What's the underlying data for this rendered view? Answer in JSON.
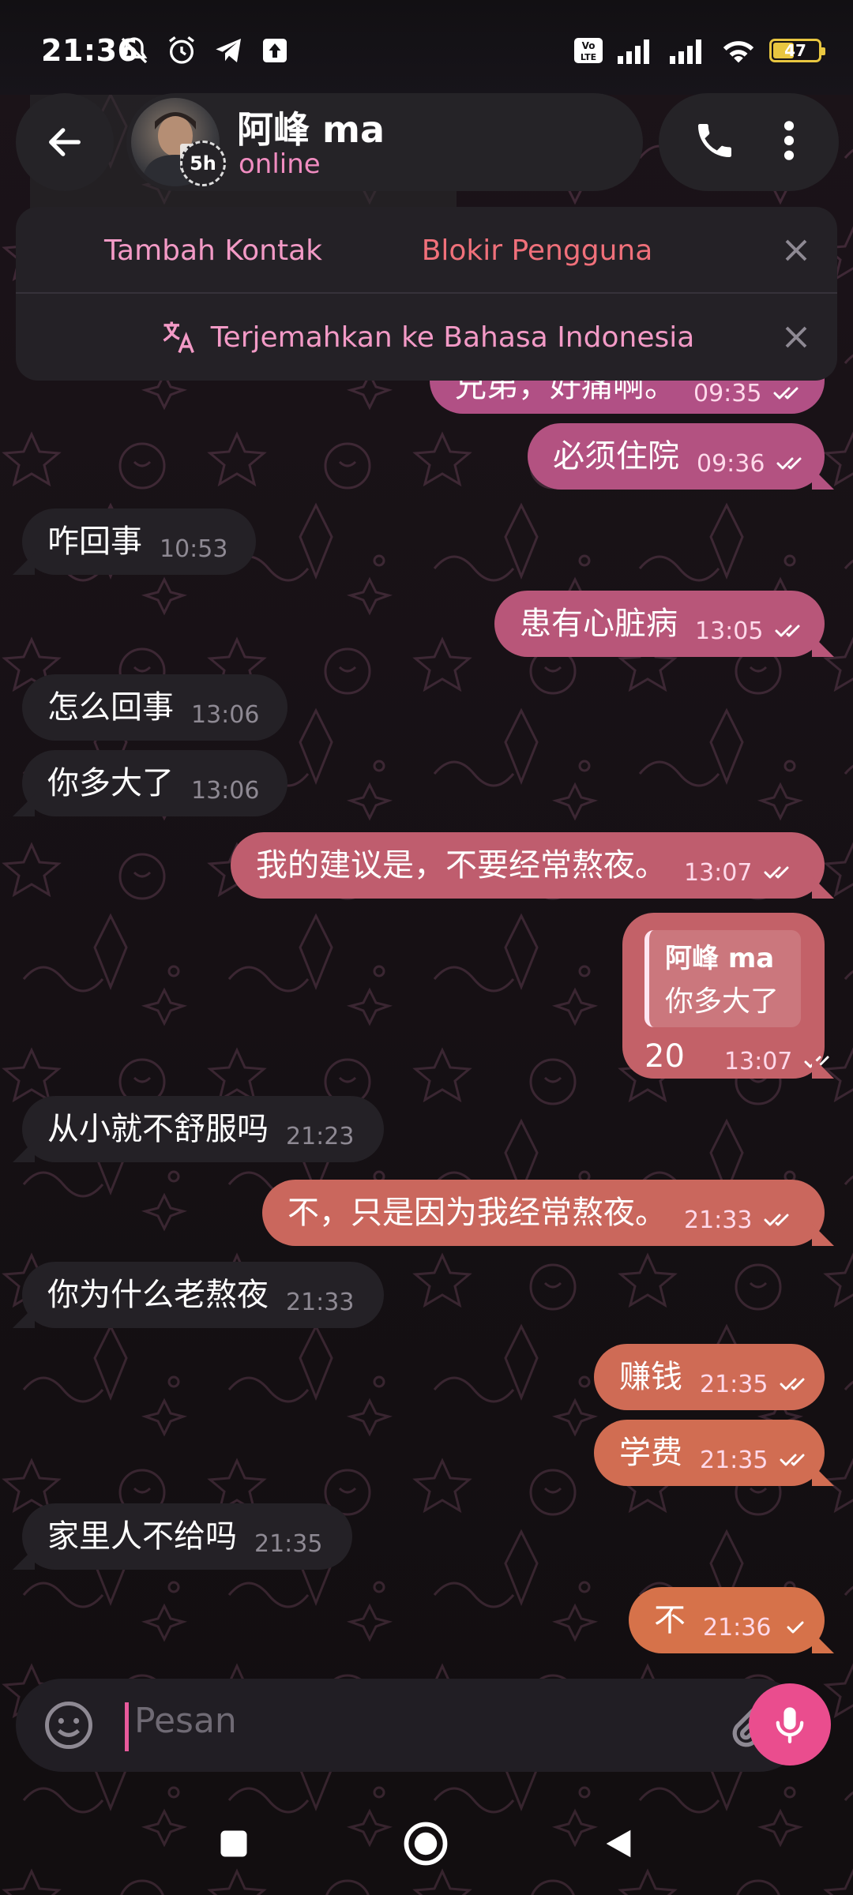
{
  "status_bar": {
    "time": "21:36",
    "battery": "47",
    "battery_level": 0.47
  },
  "header": {
    "contact_name": "阿峰 ma",
    "contact_status": "online",
    "story_badge": "5h"
  },
  "panel": {
    "add_contact": "Tambah Kontak",
    "block_user": "Blokir Pengguna",
    "translate": "Terjemahkan ke Bahasa Indonesia"
  },
  "messages": [
    {
      "dir": "out",
      "text": "兄弟，好痛啊。",
      "time": "09:35",
      "status": "read"
    },
    {
      "dir": "out",
      "text": "必须住院",
      "time": "09:36",
      "status": "read"
    },
    {
      "dir": "in",
      "text": "咋回事",
      "time": "10:53"
    },
    {
      "dir": "out",
      "text": "患有心脏病",
      "time": "13:05",
      "status": "read"
    },
    {
      "dir": "in",
      "text": "怎么回事",
      "time": "13:06"
    },
    {
      "dir": "in",
      "text": "你多大了",
      "time": "13:06"
    },
    {
      "dir": "out",
      "text": "我的建议是，不要经常熬夜。",
      "time": "13:07",
      "status": "read"
    },
    {
      "dir": "out",
      "text": "20",
      "time": "13:07",
      "status": "read",
      "reply_to": {
        "name": "阿峰 ma",
        "text": "你多大了"
      }
    },
    {
      "dir": "in",
      "text": "从小就不舒服吗",
      "time": "21:23"
    },
    {
      "dir": "out",
      "text": "不，只是因为我经常熬夜。",
      "time": "21:33",
      "status": "read"
    },
    {
      "dir": "in",
      "text": "你为什么老熬夜",
      "time": "21:33"
    },
    {
      "dir": "out",
      "text": "赚钱",
      "time": "21:35",
      "status": "read"
    },
    {
      "dir": "out",
      "text": "学费",
      "time": "21:35",
      "status": "read"
    },
    {
      "dir": "in",
      "text": "家里人不给吗",
      "time": "21:35"
    },
    {
      "dir": "out",
      "text": "不",
      "time": "21:36",
      "status": "sent"
    }
  ],
  "composer": {
    "placeholder": "Pesan"
  },
  "colors": {
    "accent": "#ea4d8e",
    "incoming_bubble": "#242126",
    "gradient_top": "#b04f86",
    "gradient_bottom": "#d6724a"
  }
}
